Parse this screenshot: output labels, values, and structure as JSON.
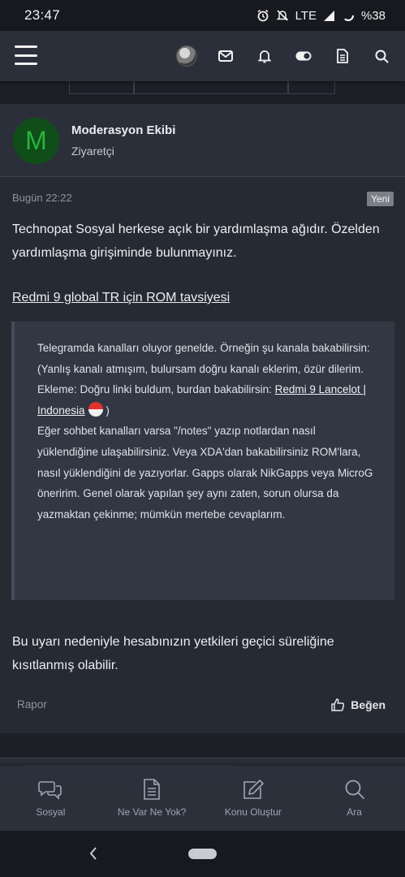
{
  "status_bar": {
    "time": "23:47",
    "network": "LTE",
    "battery": "%38"
  },
  "header": {
    "icons": [
      "menu-icon",
      "avatar",
      "envelope-icon",
      "bell-icon",
      "toggle-icon",
      "document-icon",
      "search-icon"
    ]
  },
  "post": {
    "author": {
      "initial": "M",
      "name": "Moderasyon Ekibi",
      "title": "Ziyaretçi",
      "avatar_bg": "#0f4d19",
      "avatar_fg": "#2ab33d"
    },
    "date": "Bugün 22:22",
    "badge": "Yeni",
    "intro": "Technopat Sosyal herkese açık bir yardımlaşma ağıdır. Özelden yardımlaşma girişiminde bulunmayınız.",
    "link_title": "Redmi 9 global TR için ROM tavsiyesi",
    "quote": {
      "line1": "Telegramda kanalları oluyor genelde. Örneğin şu kanala bakabilirsin:",
      "line2": "(Yanlış kanalı atmışım, bulursam doğru kanalı eklerim, özür dilerim.",
      "line3_prefix": "Ekleme: Doğru linki buldum, burdan bakabilirsin: ",
      "line3_link": "Redmi 9 Lancelot | Indonesia",
      "line3_suffix": " )",
      "line4": "Eğer sohbet kanalları varsa \"/notes\" yazıp notlardan nasıl yüklendiğine ulaşabilirsiniz. Veya XDA'dan bakabilirsiniz ROM'lara, nasıl yüklendiğini de yazıyorlar. Gapps olarak NikGapps veya MicroG öneririm. Genel olarak yapılan şey aynı zaten, sorun olursa da yazmaktan çekinme; mümkün mertebe cevaplarım."
    },
    "notice": "Bu uyarı nedeniyle hesabınızın yetkileri geçici süreliğine kısıtlanmış olabilir.",
    "report_label": "Rapor",
    "like_label": "Beğen"
  },
  "bottom_nav": {
    "items": [
      {
        "label": "Sosyal",
        "icon": "chat-bubbles-icon"
      },
      {
        "label": "Ne Var Ne Yok?",
        "icon": "document-icon"
      },
      {
        "label": "Konu Oluştur",
        "icon": "edit-icon"
      },
      {
        "label": "Ara",
        "icon": "search-icon"
      }
    ]
  }
}
